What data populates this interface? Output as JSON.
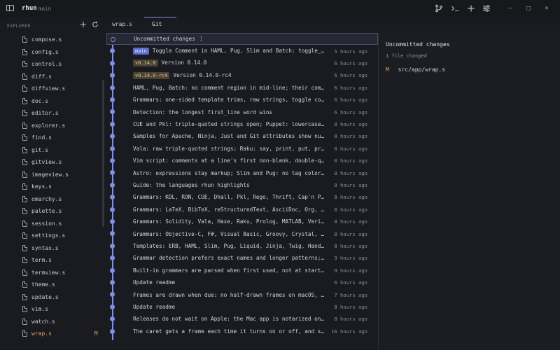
{
  "titlebar": {
    "app_name": "rhun",
    "branch": "main",
    "window_controls": [
      "–",
      "□",
      "✕"
    ]
  },
  "explorer": {
    "header": "EXPLORER",
    "files": [
      {
        "name": "compose.s",
        "status": ""
      },
      {
        "name": "config.s",
        "status": ""
      },
      {
        "name": "control.s",
        "status": ""
      },
      {
        "name": "diff.s",
        "status": ""
      },
      {
        "name": "diffview.s",
        "status": ""
      },
      {
        "name": "doc.s",
        "status": ""
      },
      {
        "name": "editor.s",
        "status": ""
      },
      {
        "name": "explorer.s",
        "status": ""
      },
      {
        "name": "find.s",
        "status": ""
      },
      {
        "name": "git.s",
        "status": ""
      },
      {
        "name": "gitview.s",
        "status": ""
      },
      {
        "name": "imageview.s",
        "status": ""
      },
      {
        "name": "keys.s",
        "status": ""
      },
      {
        "name": "omarchy.s",
        "status": ""
      },
      {
        "name": "palette.s",
        "status": ""
      },
      {
        "name": "session.s",
        "status": ""
      },
      {
        "name": "settings.s",
        "status": ""
      },
      {
        "name": "syntax.s",
        "status": ""
      },
      {
        "name": "term.s",
        "status": ""
      },
      {
        "name": "termview.s",
        "status": ""
      },
      {
        "name": "theme.s",
        "status": ""
      },
      {
        "name": "update.s",
        "status": ""
      },
      {
        "name": "vim.s",
        "status": ""
      },
      {
        "name": "watch.s",
        "status": ""
      },
      {
        "name": "wrap.s",
        "status": "M"
      }
    ]
  },
  "tabs": [
    {
      "label": "wrap.s",
      "active": false
    },
    {
      "label": "Git",
      "active": true
    }
  ],
  "commits": [
    {
      "message": "Uncommitted changes",
      "count": "1",
      "time": "",
      "tag": "",
      "tag_type": ""
    },
    {
      "message": "Toggle Comment in HAML, Pug, Slim and Batch: toggle_comment…",
      "time": "5 hours ago",
      "tag": "main",
      "tag_type": "branch"
    },
    {
      "message": "Version 0.14.0",
      "time": "6 hours ago",
      "tag": "v0.14.0",
      "tag_type": "version"
    },
    {
      "message": "Version 0.14.0-rc4",
      "time": "6 hours ago",
      "tag": "v0.14.0-rc4",
      "tag_type": "version"
    },
    {
      "message": "HAML, Pug, Batch: no comment region in mid-line; their comment to…",
      "time": "6 hours ago",
      "tag": "",
      "tag_type": ""
    },
    {
      "message": "Grammars: one-sided template trims, raw strings, toggle comments,…",
      "time": "6 hours ago",
      "tag": "",
      "tag_type": ""
    },
    {
      "message": "Detection: the longest first_line word wins",
      "time": "6 hours ago",
      "tag": "",
      "tag_type": ""
    },
    {
      "message": "CUE and Pkl: triple-quoted strings open; Puppet: lowercase resour…",
      "time": "8 hours ago",
      "tag": "",
      "tag_type": ""
    },
    {
      "message": "Samples for Apache, Ninja, Just and Git attributes show numbers",
      "time": "8 hours ago",
      "tag": "",
      "tag_type": ""
    },
    {
      "message": "Vala: raw triple-quoted strings; Raku: say, print, put, printf; s…",
      "time": "8 hours ago",
      "tag": "",
      "tag_type": ""
    },
    {
      "message": "Vim script: comments at a line's first non-blank, double-quoted s…",
      "time": "8 hours ago",
      "tag": "",
      "tag_type": ""
    },
    {
      "message": "Astro: expressions stay markup; Slim and Pug: no tag colors on ev…",
      "time": "8 hours ago",
      "tag": "",
      "tag_type": ""
    },
    {
      "message": "Guide: the languages rhun highlights",
      "time": "8 hours ago",
      "tag": "",
      "tag_type": ""
    },
    {
      "message": "Grammars: KDL, RON, CUE, Dhall, Pkl, Rego, Thrift, Cap'n Proto, P…",
      "time": "8 hours ago",
      "tag": "",
      "tag_type": ""
    },
    {
      "message": "Grammars: LaTeX, BibTeX, reStructuredText, AsciiDoc, Org, Typst, …",
      "time": "8 hours ago",
      "tag": "",
      "tag_type": ""
    },
    {
      "message": "Grammars: Solidity, Vala, Haxe, Raku, Prolog, MATLAB, Verilog, VH…",
      "time": "8 hours ago",
      "tag": "",
      "tag_type": ""
    },
    {
      "message": "Grammars: Objective-C, F#, Visual Basic, Groovy, Crystal, Elm, Pu…",
      "time": "8 hours ago",
      "tag": "",
      "tag_type": ""
    },
    {
      "message": "Templates: ERB, HAML, Slim, Pug, Liquid, Jinja, Twig, Handlebars,…",
      "time": "8 hours ago",
      "tag": "",
      "tag_type": ""
    },
    {
      "message": "Grammar detection prefers exact names and longer patterns; prefix…",
      "time": "9 hours ago",
      "tag": "",
      "tag_type": ""
    },
    {
      "message": "Built-in grammars are parsed when first used, not at startup",
      "time": "9 hours ago",
      "tag": "",
      "tag_type": ""
    },
    {
      "message": "Update readme",
      "time": "6 hours ago",
      "tag": "",
      "tag_type": ""
    },
    {
      "message": "Frames are drawn when due: no half-drawn frames on macOS, no late…",
      "time": "7 hours ago",
      "tag": "",
      "tag_type": ""
    },
    {
      "message": "Update readme",
      "time": "8 hours ago",
      "tag": "",
      "tag_type": ""
    },
    {
      "message": "Releases do not wait on Apple: the Mac app is notarized only when…",
      "time": "8 hours ago",
      "tag": "",
      "tag_type": ""
    },
    {
      "message": "The caret gets a frame each time it turns on or off, and stays on…",
      "time": "16 hours ago",
      "tag": "",
      "tag_type": ""
    }
  ],
  "details": {
    "title": "Uncommitted changes",
    "subtitle": "1 file changed",
    "files": [
      {
        "status": "M",
        "path": "src/app/wrap.s"
      }
    ]
  },
  "colors": {
    "accent": "#7f8fe6",
    "modified": "#e0a55c",
    "background": "#1a1b20"
  }
}
